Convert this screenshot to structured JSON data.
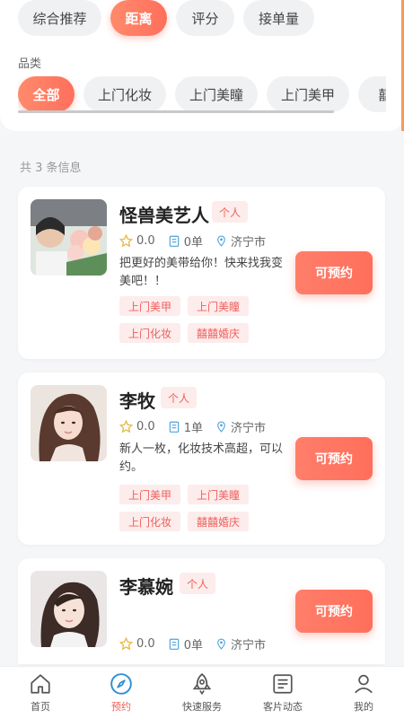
{
  "sort_tabs": [
    {
      "label": "综合推荐",
      "active": false
    },
    {
      "label": "距离",
      "active": true
    },
    {
      "label": "评分",
      "active": false
    },
    {
      "label": "接单量",
      "active": false
    }
  ],
  "category": {
    "label": "品类",
    "items": [
      {
        "label": "全部",
        "active": true
      },
      {
        "label": "上门化妆",
        "active": false
      },
      {
        "label": "上门美瞳",
        "active": false
      },
      {
        "label": "上门美甲",
        "active": false
      },
      {
        "label": "囍",
        "active": false
      }
    ]
  },
  "result_count": "共 3 条信息",
  "artists": [
    {
      "name": "怪兽美艺人",
      "type": "个人",
      "rating": "0.0",
      "orders": "0单",
      "city": "济宁市",
      "description": "把更好的美带给你！快来找我变美吧！！",
      "tags": [
        "上门美甲",
        "上门美瞳",
        "上门化妆",
        "囍囍婚庆"
      ],
      "button": "可预约"
    },
    {
      "name": "李牧",
      "type": "个人",
      "rating": "0.0",
      "orders": "1单",
      "city": "济宁市",
      "description": "新人一枚，化妆技术高超，可以约。",
      "tags": [
        "上门美甲",
        "上门美瞳",
        "上门化妆",
        "囍囍婚庆"
      ],
      "button": "可预约"
    },
    {
      "name": "李慕婉",
      "type": "个人",
      "rating": "0.0",
      "orders": "0单",
      "city": "济宁市",
      "description": "",
      "tags": [],
      "button": "可预约"
    }
  ],
  "tabbar": [
    {
      "label": "首页",
      "icon": "home-icon",
      "active": false
    },
    {
      "label": "预约",
      "icon": "compass-icon",
      "active": true
    },
    {
      "label": "快速服务",
      "icon": "rocket-icon",
      "active": false
    },
    {
      "label": "客片动态",
      "icon": "gallery-icon",
      "active": false
    },
    {
      "label": "我的",
      "icon": "user-icon",
      "active": false
    }
  ],
  "colors": {
    "accent": "#ff6f5b",
    "tag_bg": "#fdecec",
    "tag_text": "#ef5f5a"
  }
}
